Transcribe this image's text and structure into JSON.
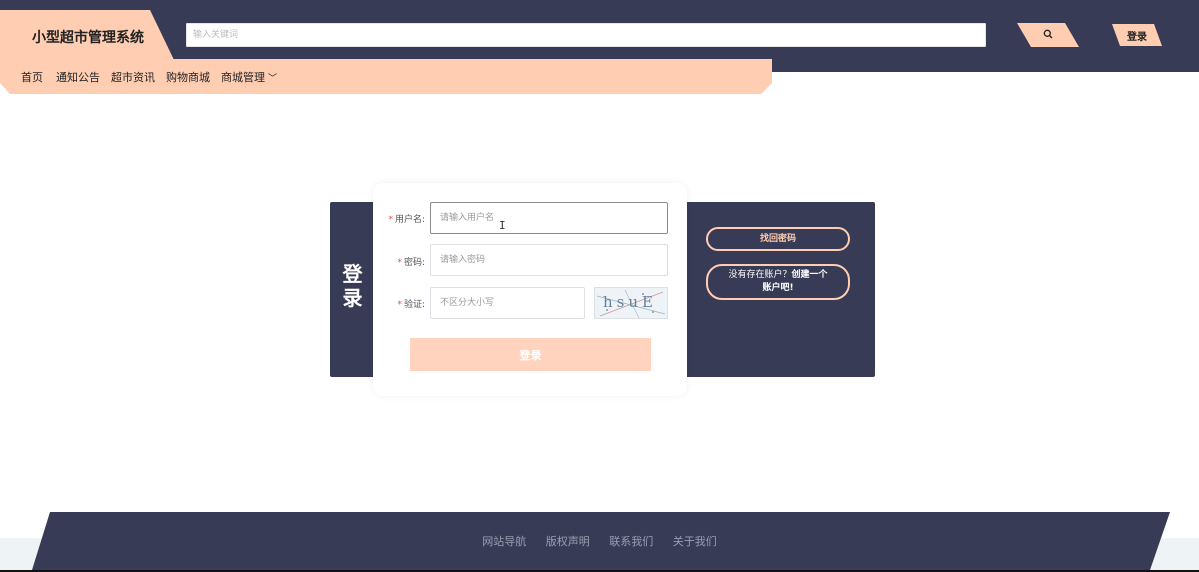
{
  "header": {
    "logo_text": "小型超市管理系统",
    "search_placeholder": "输入关键词",
    "search_icon": "search-icon",
    "login_label": "登录"
  },
  "nav": {
    "items": [
      "首页",
      "通知公告",
      "超市资讯",
      "购物商城",
      "商城管理"
    ],
    "dropdown_icon": "chevron-down-icon"
  },
  "login": {
    "panel_title_line1": "登",
    "panel_title_line2": "录",
    "required_mark": "*",
    "username_label": "用户名:",
    "username_placeholder": "请输入用户名",
    "password_label": "密码:",
    "password_placeholder": "请输入密码",
    "captcha_label": "验证:",
    "captcha_placeholder": "不区分大小写",
    "captcha_text": "hsuE",
    "submit_label": "登录",
    "forgot_label": "找回密码",
    "register_prefix": "没有存在账户？",
    "register_strong": "创建一个账户吧!"
  },
  "footer": {
    "links": [
      "网站导航",
      "版权声明",
      "联系我们",
      "关于我们"
    ]
  },
  "colors": {
    "dark_navy": "#373b56",
    "peach": "#ffcdb2",
    "required": "#e8493c"
  }
}
